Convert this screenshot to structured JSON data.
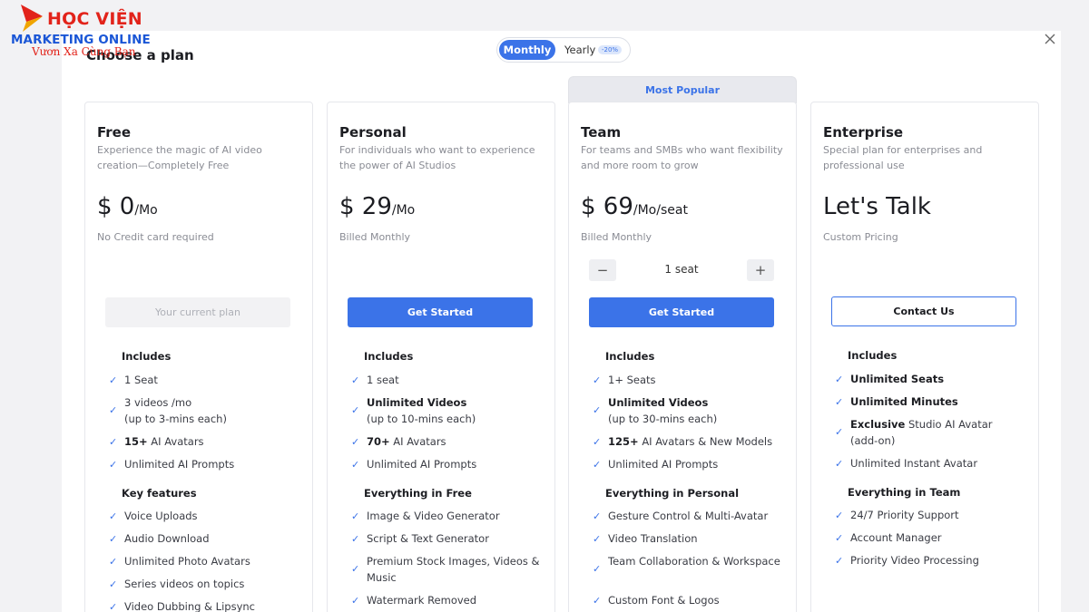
{
  "logo": {
    "top": "HỌC VIỆN",
    "mid": "MARKETING ONLINE",
    "sub": "Vươn Xa Cùng Bạn"
  },
  "header": {
    "title": "Choose a plan"
  },
  "billing_toggle": {
    "monthly": "Monthly",
    "yearly": "Yearly",
    "discount": "-20%"
  },
  "popular_label": "Most Popular",
  "colors": {
    "accent": "#3b73e8",
    "logo_red": "#e2231a",
    "logo_blue": "#1a56d6"
  },
  "plans": {
    "free": {
      "name": "Free",
      "description": "Experience the magic of AI video creation—Completely Free",
      "price": "$ 0",
      "unit": "/Mo",
      "billing": "No Credit card required",
      "cta": "Your current plan",
      "includes_title": "Includes",
      "includes": [
        "1 Seat",
        "3 videos /mo",
        "(up to 3-mins each)",
        "15+",
        "AI Avatars",
        "Unlimited AI Prompts"
      ],
      "features_title": "Key features",
      "features": [
        "Voice Uploads",
        "Audio Download",
        "Unlimited Photo Avatars",
        "Series videos on topics",
        "Video Dubbing & Lipsync"
      ]
    },
    "personal": {
      "name": "Personal",
      "description": "For individuals who want to experience the power of AI Studios",
      "price": "$ 29",
      "unit": "/Mo",
      "billing": "Billed Monthly",
      "cta": "Get Started",
      "includes_title": "Includes",
      "includes": [
        "1 seat",
        "Unlimited Videos",
        "(up to 10-mins each)",
        "70+",
        "AI Avatars",
        "Unlimited AI Prompts"
      ],
      "features_title": "Everything in Free",
      "features": [
        "Image & Video Generator",
        "Script & Text Generator",
        "Premium Stock Images, Videos & Music",
        "Watermark Removed"
      ]
    },
    "team": {
      "name": "Team",
      "description": "For teams and SMBs who want flexibility and more room to grow",
      "price": "$ 69",
      "unit": "/Mo/seat",
      "billing": "Billed Monthly",
      "seats": "1 seat",
      "cta": "Get Started",
      "includes_title": "Includes",
      "includes": [
        "1+ Seats",
        "Unlimited Videos",
        "(up to 30-mins each)",
        "125+",
        "AI Avatars & New Models",
        "Unlimited AI Prompts"
      ],
      "features_title": "Everything in Personal",
      "features": [
        "Gesture Control & Multi-Avatar",
        "Video Translation",
        "Team Collaboration & Workspace",
        "Custom Font & Logos"
      ]
    },
    "enterprise": {
      "name": "Enterprise",
      "description": "Special plan for enterprises and professional use",
      "price": "Let's Talk",
      "billing": "Custom Pricing",
      "cta": "Contact Us",
      "includes_title": "Includes",
      "includes": [
        "Unlimited Seats",
        "Unlimited Minutes",
        "Exclusive",
        "Studio AI Avatar",
        "(add-on)",
        "Unlimited Instant Avatar"
      ],
      "features_title": "Everything in Team",
      "features": [
        "24/7 Priority Support",
        "Account Manager",
        "Priority Video Processing"
      ]
    }
  }
}
